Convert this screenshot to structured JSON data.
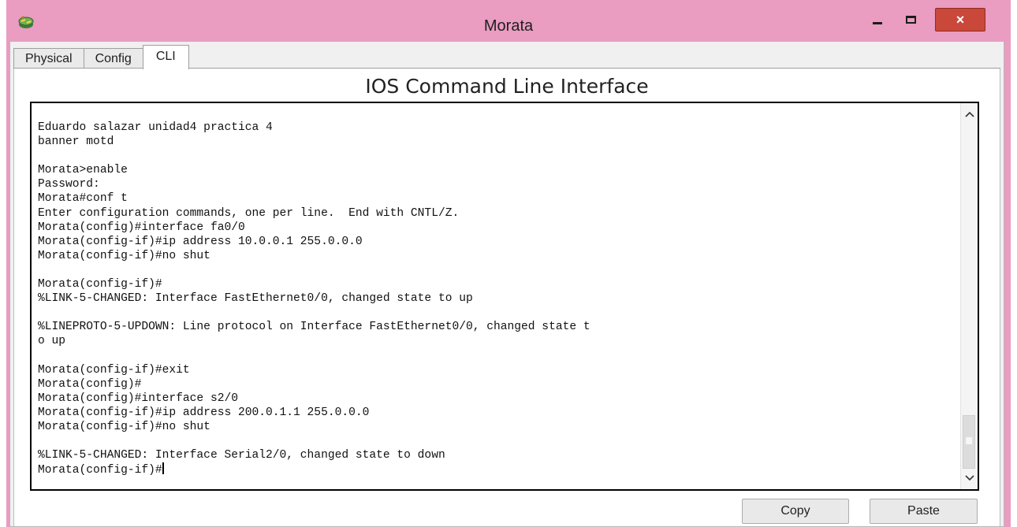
{
  "window": {
    "title": "Morata",
    "close_glyph": "×"
  },
  "tabs": [
    {
      "label": "Physical",
      "active": false
    },
    {
      "label": "Config",
      "active": false
    },
    {
      "label": "CLI",
      "active": true
    }
  ],
  "cli": {
    "heading": "IOS Command Line Interface",
    "terminal_text": "Eduardo salazar unidad4 practica 4\nbanner motd\n\nMorata>enable\nPassword:\nMorata#conf t\nEnter configuration commands, one per line.  End with CNTL/Z.\nMorata(config)#interface fa0/0\nMorata(config-if)#ip address 10.0.0.1 255.0.0.0\nMorata(config-if)#no shut\n\nMorata(config-if)#\n%LINK-5-CHANGED: Interface FastEthernet0/0, changed state to up\n\n%LINEPROTO-5-UPDOWN: Line protocol on Interface FastEthernet0/0, changed state t\no up\n\nMorata(config-if)#exit\nMorata(config)#\nMorata(config)#interface s2/0\nMorata(config-if)#ip address 200.0.1.1 255.0.0.0\nMorata(config-if)#no shut\n\n%LINK-5-CHANGED: Interface Serial2/0, changed state to down\nMorata(config-if)#"
  },
  "buttons": {
    "copy": "Copy",
    "paste": "Paste"
  },
  "icons": {
    "app": "packet-tracer-router-icon",
    "minimize": "minimize-icon",
    "maximize": "maximize-icon",
    "close": "close-icon",
    "scroll_up": "chevron-up-icon",
    "scroll_down": "chevron-down-icon"
  },
  "colors": {
    "titlebar": "#ea9cc1",
    "close_button": "#c9483a",
    "panel": "#ffffff",
    "terminal_border": "#000000"
  }
}
